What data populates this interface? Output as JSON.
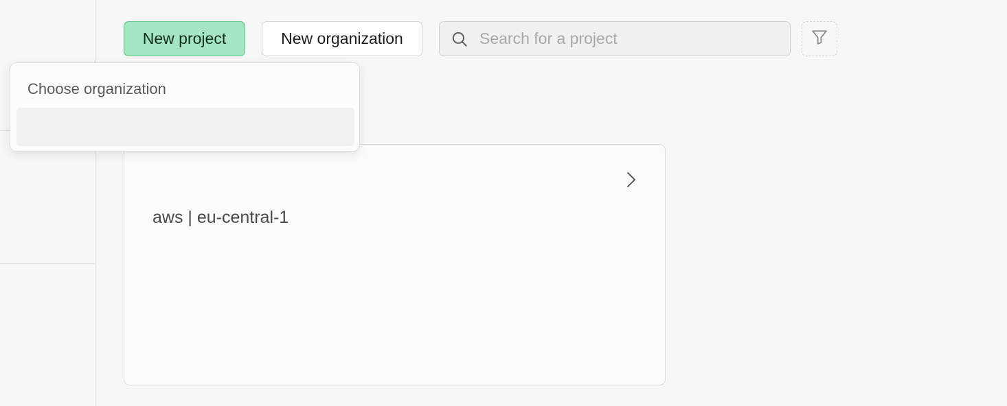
{
  "toolbar": {
    "new_project_label": "New project",
    "new_organization_label": "New organization",
    "search_placeholder": "Search for a project",
    "search_value": ""
  },
  "dropdown": {
    "heading": "Choose organization",
    "items": [
      {
        "label": ""
      }
    ]
  },
  "project_card": {
    "region": "aws | eu-central-1"
  },
  "icons": {
    "search": "search-icon",
    "filter": "filter-icon",
    "chevron": "chevron-right-icon"
  },
  "colors": {
    "primary_bg": "#a6e5c3",
    "primary_border": "#5cc48d",
    "page_bg": "#f7f7f7"
  }
}
